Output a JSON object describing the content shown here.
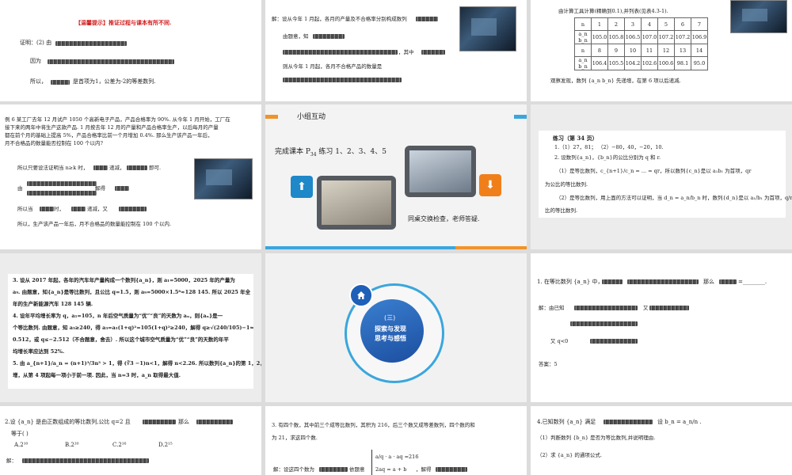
{
  "slides": {
    "s1": {
      "header": "【温馨提示】推证过程与课本有所不同.",
      "lines": [
        "证明：(2) 由",
        "因为",
        "所以，",
        "是首项为1，公差为-2的等差数列."
      ]
    },
    "s2": {
      "lines": [
        "解：设从今年 1 月起，各月的产量及不合格率分别构成数列",
        "由题意，知",
        "，其中",
        "则从今年 1 月起，各月不合格产品的数量是"
      ]
    },
    "s3": {
      "caption": "由计算工具计算(精确到0.1),并列表(见表4.3-1).",
      "table": [
        [
          "n",
          "1",
          "2",
          "3",
          "4",
          "5",
          "6",
          "7"
        ],
        [
          "a_n b_n",
          "105.0",
          "105.8",
          "106.5",
          "107.0",
          "107.2",
          "107.2",
          "106.9"
        ],
        [
          "n",
          "8",
          "9",
          "10",
          "11",
          "12",
          "13",
          "14"
        ],
        [
          "a_n b_n",
          "106.4",
          "105.5",
          "104.2",
          "102.6",
          "100.6",
          "98.1",
          "95.0"
        ]
      ],
      "note": "观察发现，数列 {a_n b_n} 先递增，在第 6 项以后递减."
    },
    "s4": {
      "lines": [
        "例 6 某工厂去年 12 月试产 1050 个高新电子产品，产品合格率为 90%. 从今年 1 月开始，工厂在",
        "接下来的两年中将生产这款产品. 1 月按去年 12 月的产量和产品合格率生产，以后每月的产量",
        "都在前个月的基础上提高 5%，产品合格率比前一个月增加 0.4%. 那么生产该产品一年后，",
        "月不合格品的数量能否控制在 100 个以内?",
        "所以只要设法证明当 n≥k 时，",
        "递减，",
        "即可.",
        "由",
        "解得",
        "所以当",
        "时，",
        "递减，又",
        "所以，生产该产品一年后，月不合格品的数量能控制在 100 个以内."
      ]
    },
    "s5": {
      "title": "小组互动",
      "instruction": "完成课本 P",
      "sub": "34",
      "instruction2": " 练习 1、2、3、4、5",
      "footer": "同桌交换检查，老师答疑.",
      "accent_orange": "#f0932b",
      "accent_blue": "#3aa6dd"
    },
    "s6": {
      "title": "练习（第 34 页）",
      "lines": [
        "1.（1）27，81；      （2）−80，40，−20，10.",
        "2. 设数列{a_n}，{b_n}的公比分别为 q 和 r.",
        "（1）是等比数列，c_{n+1}/c_n = ... = qr，所以数列{c_n}是以 a₁b₁ 为首项，qr",
        "为公比的等比数列.",
        "（2）是等比数列，用上面的方法可以证明，当 d_n = a_n/b_n 时，数列{d_n}是以 a₁/b₁ 为首项，q/r 为公",
        "比的等比数列."
      ]
    },
    "s7": {
      "lines": [
        "3. 设从 2017 年起，各年的汽车年产量构成一个数列{a_n}，则 a₁=5000，2025 年的产量为",
        "a₉. 由题意，知{a_n}是等比数列，且公比 q=1.5，则 a₉=5000×1.5⁸≈128 145. 所以 2025 年全",
        "年的生产新能源汽车 128 145 辆.",
        "4. 设年平均增长率为 q，a₁=105，n 年后空气质量为“优”“良”的天数为 aₙ，则{aₙ}是一",
        "个等比数列. 由题意，知 a₃≥240，得 a₃=a₁(1+q)²=105(1+q)²≥240，解得 q≥√(240/105)−1≈",
        "0.512，或 q≤−2.512（不合题意，舍去）. 所以这个城市空气质量为“优”“良”的天数的年平",
        "均增长率应达到 52%.",
        "5. 由 a_{n+1}/a_n = (n+1)³/3n³ > 1，得 (∛3 −1)n<1，解得 n<2.26. 所以数列{a_n}的第 1，2，3 项递",
        "增，从第 4 项起每一项小于前一项. 因此，当 n=3 时，a_n 取得最大值."
      ]
    },
    "s8": {
      "label1": "(三)",
      "label2": "探索与发现",
      "label3": "思考与感悟",
      "home_icon": "home-icon"
    },
    "s9": {
      "q": "1. 在等比数列 {a_n} 中，",
      "q2": "那么",
      "q3": "=________.",
      "sol": "解：由已知",
      "sol2": "又",
      "sol3": "又 q<0",
      "answer": "答案：5"
    },
    "s10": {
      "q": "2.设 {a_n} 是由正数组成的等比数列,公比 q=2 且",
      "q2": "那么",
      "eq": "等于(    )",
      "options": [
        "A.2¹⁰",
        "B.2²⁰",
        "C.2¹⁶",
        "D.2¹⁵"
      ],
      "sol": "解："
    },
    "s11": {
      "q": "3. 有四个数，其中前三个成等比数列，其积为 216，后三个数又成等差数列，四个数的和",
      "q2": "为 21，求这四个数.",
      "sol": "解：设这四个数为",
      "sol2": "依题意",
      "sys1": "a/q · a · aq =216",
      "sys2": "2aq = a + b",
      "sol3": "，解得"
    },
    "s12": {
      "q": "4.已知数列 {a_n} 满足",
      "q2": "设 b_n = a_n/n .",
      "items": [
        "（1）判断数列 {b_n} 是否为等比数列,并说明理由.",
        "（2）求 {a_n} 的通项公式."
      ]
    }
  }
}
